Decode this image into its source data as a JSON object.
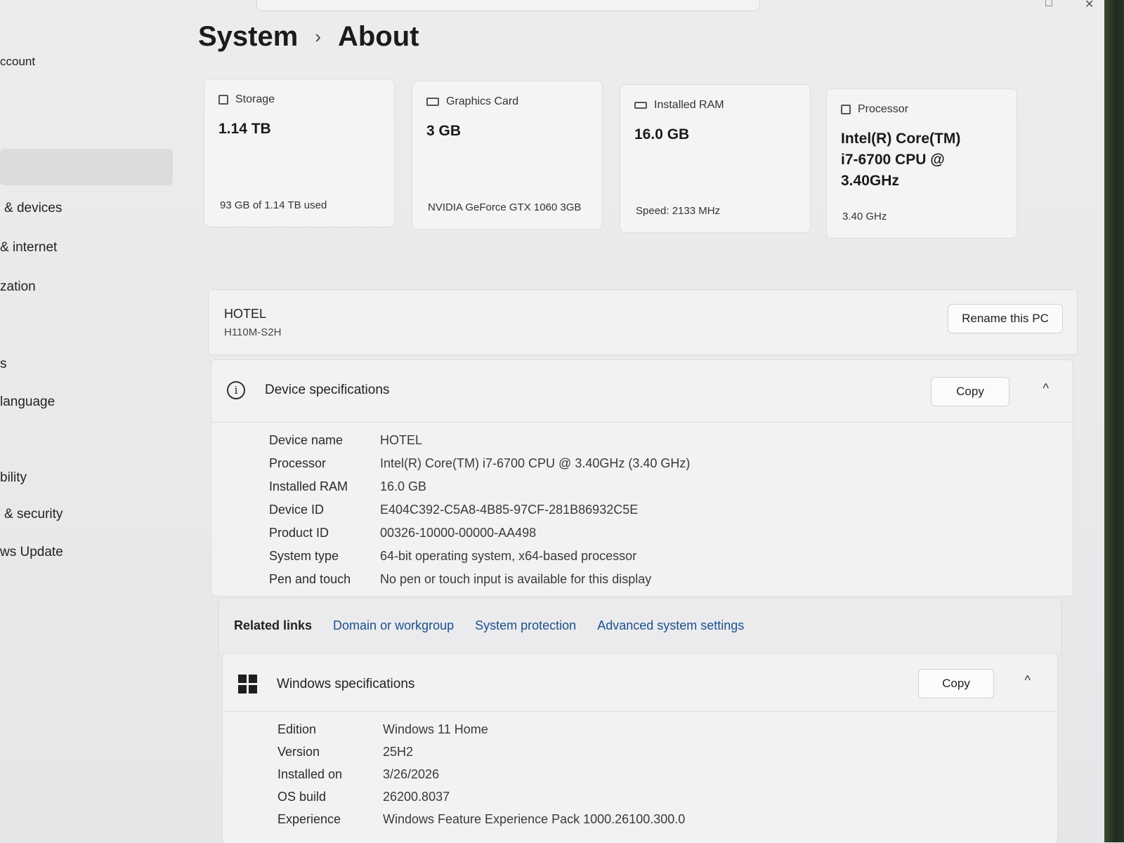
{
  "window": {
    "max_glyph": "□",
    "close_glyph": "✕"
  },
  "sidebar": {
    "items": [
      {
        "label": "ccount"
      },
      {
        "label": "& devices"
      },
      {
        "label": "& internet"
      },
      {
        "label": "zation"
      },
      {
        "label": "s"
      },
      {
        "label": "language"
      },
      {
        "label": "bility"
      },
      {
        "label": "& security"
      },
      {
        "label": "ws Update"
      }
    ]
  },
  "header": {
    "section": "System",
    "separator": "›",
    "page": "About"
  },
  "cards": [
    {
      "icon": "storage-icon",
      "title": "Storage",
      "value": "1.14 TB",
      "sub": "93 GB of 1.14 TB used"
    },
    {
      "icon": "graphics-card-icon",
      "title": "Graphics Card",
      "value": "3 GB",
      "sub": "NVIDIA GeForce GTX 1060 3GB"
    },
    {
      "icon": "ram-icon",
      "title": "Installed RAM",
      "value": "16.0 GB",
      "sub": "Speed: 2133 MHz"
    },
    {
      "icon": "processor-icon",
      "title": "Processor",
      "value": "Intel(R) Core(TM) i7-6700 CPU @ 3.40GHz",
      "sub": "3.40 GHz"
    }
  ],
  "pc": {
    "name": "HOTEL",
    "model": "H110M-S2H",
    "rename_label": "Rename this PC"
  },
  "device_specs": {
    "title": "Device specifications",
    "copy_label": "Copy",
    "collapse_glyph": "^",
    "rows": [
      {
        "label": "Device name",
        "value": "HOTEL"
      },
      {
        "label": "Processor",
        "value": "Intel(R) Core(TM) i7-6700 CPU @ 3.40GHz (3.40 GHz)"
      },
      {
        "label": "Installed RAM",
        "value": "16.0 GB"
      },
      {
        "label": "Device ID",
        "value": "E404C392-C5A8-4B85-97CF-281B86932C5E"
      },
      {
        "label": "Product ID",
        "value": "00326-10000-00000-AA498"
      },
      {
        "label": "System type",
        "value": "64-bit operating system, x64-based processor"
      },
      {
        "label": "Pen and touch",
        "value": "No pen or touch input is available for this display"
      }
    ]
  },
  "related_links": {
    "label": "Related links",
    "links": [
      "Domain or workgroup",
      "System protection",
      "Advanced system settings"
    ]
  },
  "windows_specs": {
    "title": "Windows specifications",
    "copy_label": "Copy",
    "collapse_glyph": "^",
    "rows": [
      {
        "label": "Edition",
        "value": "Windows 11 Home"
      },
      {
        "label": "Version",
        "value": "25H2"
      },
      {
        "label": "Installed on",
        "value": "3/26/2026"
      },
      {
        "label": "OS build",
        "value": "26200.8037"
      },
      {
        "label": "Experience",
        "value": "Windows Feature Experience Pack 1000.26100.300.0"
      }
    ]
  }
}
